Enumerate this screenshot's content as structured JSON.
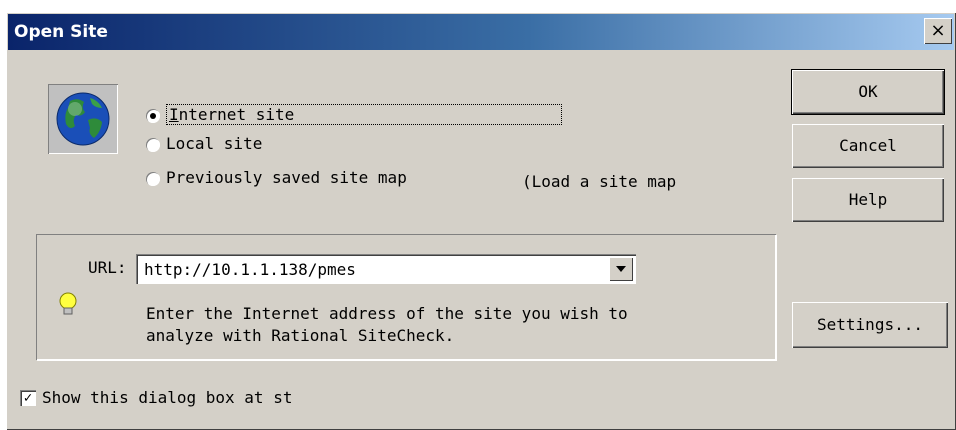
{
  "window": {
    "title": "Open Site",
    "close_glyph": "×"
  },
  "buttons": {
    "ok": "OK",
    "cancel": "Cancel",
    "help": "Help",
    "settings": "Settings..."
  },
  "site_type": {
    "options": [
      {
        "label": "Internet site",
        "selected": true
      },
      {
        "label": "Local site",
        "selected": false
      },
      {
        "label": "Previously saved site map",
        "selected": false
      }
    ],
    "extra_label": "(Load a site map"
  },
  "url": {
    "label": "URL:",
    "value": "http://10.1.1.138/pmes",
    "hint_line1": "Enter the Internet address of the site you wish to",
    "hint_line2": "analyze with Rational SiteCheck."
  },
  "show_dialog": {
    "label": "Show this dialog box at st",
    "checked": true
  },
  "icons": {
    "globe": "globe-icon",
    "hint": "lightbulb-icon",
    "dropdown": "chevron-down-icon"
  }
}
